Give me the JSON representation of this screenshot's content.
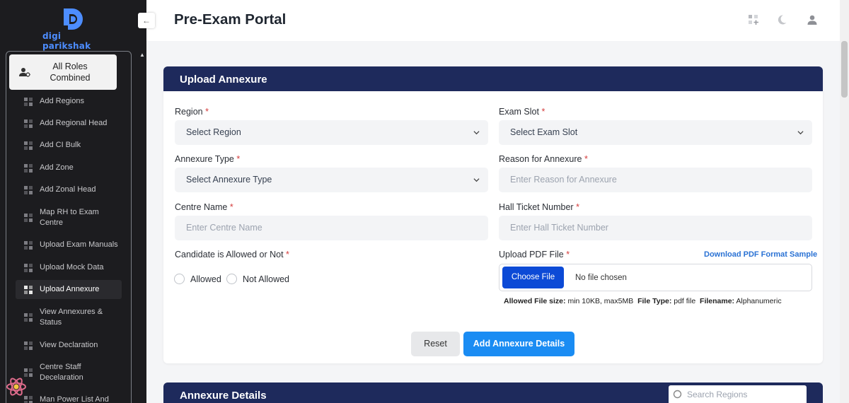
{
  "brand": {
    "name": "digi parikshak"
  },
  "sidebar": {
    "role": "All Roles Combined",
    "items": [
      {
        "label": "Add Regions"
      },
      {
        "label": "Add Regional Head"
      },
      {
        "label": "Add CI Bulk"
      },
      {
        "label": "Add Zone"
      },
      {
        "label": "Add Zonal Head"
      },
      {
        "label": "Map RH to Exam Centre"
      },
      {
        "label": "Upload Exam Manuals"
      },
      {
        "label": "Upload Mock Data"
      },
      {
        "label": "Upload Annexure",
        "active": true
      },
      {
        "label": "View Annexures & Status"
      },
      {
        "label": "View Declaration"
      },
      {
        "label": "Centre Staff Decelaration"
      },
      {
        "label": "Man Power List And"
      }
    ]
  },
  "header": {
    "collapse_icon": "←",
    "title": "Pre-Exam Portal",
    "icons": [
      "apps-add-icon",
      "theme-moon-icon",
      "user-icon"
    ]
  },
  "form": {
    "title": "Upload Annexure",
    "required_mark": "*",
    "region": {
      "label": "Region",
      "value": "Select Region"
    },
    "exam_slot": {
      "label": "Exam Slot",
      "value": "Select Exam Slot"
    },
    "annexure_type": {
      "label": "Annexure Type",
      "value": "Select Annexure Type"
    },
    "reason": {
      "label": "Reason for Annexure",
      "placeholder": "Enter Reason for Annexure"
    },
    "centre_name": {
      "label": "Centre Name",
      "placeholder": "Enter Centre Name"
    },
    "hall_ticket": {
      "label": "Hall Ticket Number",
      "placeholder": "Enter Hall Ticket Number"
    },
    "candidate_allowed": {
      "label": "Candidate is Allowed or Not",
      "options": [
        "Allowed",
        "Not Allowed"
      ]
    },
    "pdf": {
      "label": "Upload PDF File",
      "download_link": "Download PDF Format Sample",
      "choose_button": "Choose File",
      "no_file": "No file chosen",
      "hint_size_label": "Allowed File size:",
      "hint_size_value": "min 10KB, max5MB",
      "hint_type_label": "File Type:",
      "hint_type_value": "pdf file",
      "hint_name_label": "Filename:",
      "hint_name_value": "Alphanumeric"
    },
    "reset_button": "Reset",
    "submit_button": "Add Annexure Details"
  },
  "details": {
    "title": "Annexure Details",
    "search_placeholder": "Search Regions"
  }
}
